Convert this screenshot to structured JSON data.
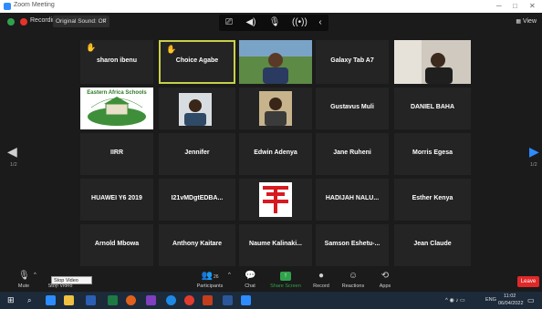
{
  "window": {
    "title": "Zoom Meeting",
    "minimize": "─",
    "maximize": "□",
    "close": "✕"
  },
  "topbar": {
    "recording_label": "Recording",
    "original_sound": "Original Sound: Off",
    "view_label": "View"
  },
  "tiles": [
    {
      "name": "sharon ibenu",
      "hand": true
    },
    {
      "name": "Choice Agabe",
      "hand": true
    },
    {
      "name": "",
      "video": "photo-man-outdoors"
    },
    {
      "name": "Galaxy Tab A7"
    },
    {
      "name": "",
      "video": "photo-man-room"
    },
    {
      "name": "",
      "video": "eastern-africa-schools-logo"
    },
    {
      "name": "",
      "video": "photo-man-indoor"
    },
    {
      "name": "",
      "video": "photo-man-portrait"
    },
    {
      "name": "Gustavus Muli"
    },
    {
      "name": "DANIEL BAHA"
    },
    {
      "name": "IIRR"
    },
    {
      "name": "Jennifer"
    },
    {
      "name": "Edwin Adenya"
    },
    {
      "name": "Jane Ruheni"
    },
    {
      "name": "Morris  Egesa"
    },
    {
      "name": "HUAWEI Y6 2019"
    },
    {
      "name": "I21vMDgtEDBA..."
    },
    {
      "name": "",
      "video": "red-logo"
    },
    {
      "name": "HADIJAH NALU..."
    },
    {
      "name": "Esther Kenya"
    },
    {
      "name": "Arnold Mbowa"
    },
    {
      "name": "Anthony Kaitare"
    },
    {
      "name": "Naume  Kalinaki..."
    },
    {
      "name": "Samson  Eshetu-..."
    },
    {
      "name": "Jean Claude"
    }
  ],
  "logo_text": "Eastern Africa Schools",
  "pager": {
    "left": "1/2",
    "right": "1/2"
  },
  "toolbar": {
    "mute": "Mute",
    "stop_video": "Stop Video",
    "tooltip": "Stop Video (Alt+V)",
    "participants": "Participants",
    "participants_count": "26",
    "chat": "Chat",
    "share_screen": "Share Screen",
    "record": "Record",
    "reactions": "Reactions",
    "apps": "Apps",
    "leave": "Leave"
  },
  "taskbar": {
    "lang": "ENG",
    "time": "11:02",
    "date": "06/04/2022"
  },
  "colors": {
    "accent": "#2d8cff",
    "leave": "#e02828",
    "share": "#31a24c",
    "hand": "#f8b31c",
    "active_border": "#c8d04a"
  }
}
